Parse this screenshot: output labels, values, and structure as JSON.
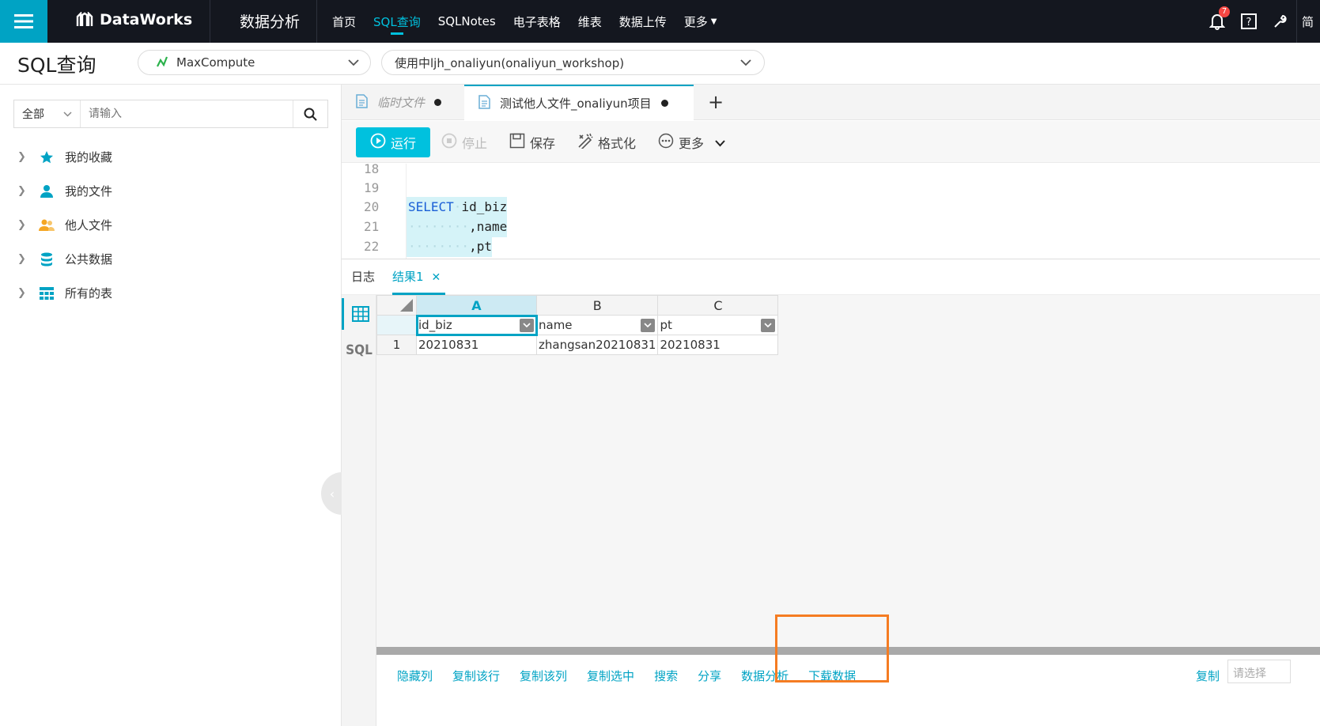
{
  "topbar": {
    "brand": "DataWorks",
    "module": "数据分析",
    "nav": [
      "首页",
      "SQL查询",
      "SQLNotes",
      "电子表格",
      "维表",
      "数据上传",
      "更多"
    ],
    "active_nav": "SQL查询",
    "notification_count": "7",
    "lang": "简"
  },
  "subbar": {
    "page_title": "SQL查询",
    "engine": "MaxCompute",
    "project": "使用中ljh_onaliyun(onaliyun_workshop)"
  },
  "sidebar": {
    "scope": "全部",
    "search_placeholder": "请输入",
    "items": [
      {
        "label": "我的收藏",
        "icon": "star-icon",
        "color": "#00a3c4"
      },
      {
        "label": "我的文件",
        "icon": "user-icon",
        "color": "#00a3c4"
      },
      {
        "label": "他人文件",
        "icon": "users-icon",
        "color": "#f5a623"
      },
      {
        "label": "公共数据",
        "icon": "database-icon",
        "color": "#00a3c4"
      },
      {
        "label": "所有的表",
        "icon": "table-icon",
        "color": "#00a3c4"
      }
    ]
  },
  "tabs": {
    "tab1": "临时文件",
    "tab2": "测试他人文件_onaliyun项目"
  },
  "toolbar": {
    "run": "运行",
    "stop": "停止",
    "save": "保存",
    "format": "格式化",
    "more": "更多"
  },
  "editor": {
    "lines": [
      {
        "num": "18",
        "code": ""
      },
      {
        "num": "19",
        "code": ""
      },
      {
        "num": "20",
        "code": "SELECT id_biz"
      },
      {
        "num": "21",
        "code": ",name"
      },
      {
        "num": "22",
        "code": ",pt"
      }
    ]
  },
  "results": {
    "log_tab": "日志",
    "result_tab": "结果1",
    "columns": [
      "A",
      "B",
      "C"
    ],
    "headers": [
      "id_biz",
      "name",
      "pt"
    ],
    "rows": [
      [
        "1",
        "20210831",
        "zhangsan20210831",
        "20210831"
      ]
    ]
  },
  "footer": {
    "actions": [
      "隐藏列",
      "复制该行",
      "复制该列",
      "复制选中",
      "搜索",
      "分享",
      "数据分析",
      "下载数据"
    ],
    "copy": "复制",
    "select_hint": "请选择"
  },
  "colors": {
    "accent": "#00a3c4",
    "topbar": "#14171f",
    "highlight": "#f57c22"
  }
}
